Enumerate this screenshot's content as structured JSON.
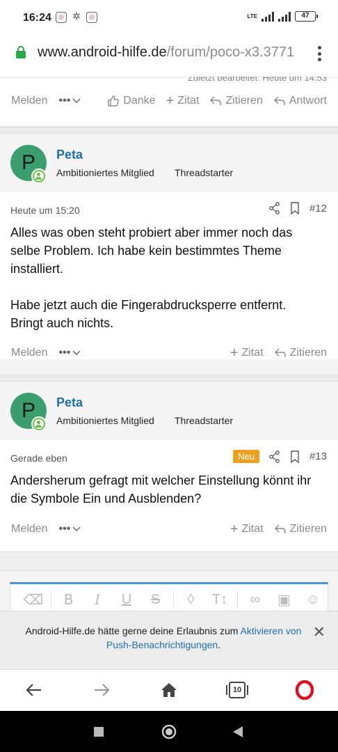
{
  "status_bar": {
    "time": "16:24",
    "battery": "47",
    "network": "LTE"
  },
  "browser": {
    "url_host": "www.android-hilfe.de",
    "url_path": "/forum/poco-x3.3771",
    "tabs_count": "10"
  },
  "top_partial": {
    "edited_text": "Zuletzt bearbeitet: Heute um 14:53"
  },
  "post_actions_first": {
    "report": "Melden",
    "thanks": "Danke",
    "quote_short": "Zitat",
    "quote": "Zitieren",
    "reply": "Antwort"
  },
  "posts": [
    {
      "author": "Peta",
      "avatar_letter": "P",
      "role": "Ambitioniertes Mitglied",
      "starter": "Threadstarter",
      "time": "Heute um 15:20",
      "number": "#12",
      "badge": "",
      "text": "Alles was oben steht probiert aber immer noch das selbe Problem. Ich habe kein bestimmtes Theme installiert.\n\nHabe jetzt auch die Fingerabdrucksperre entfernt. Bringt auch nichts.",
      "actions": {
        "report": "Melden",
        "quote_short": "Zitat",
        "quote": "Zitieren"
      }
    },
    {
      "author": "Peta",
      "avatar_letter": "P",
      "role": "Ambitioniertes Mitglied",
      "starter": "Threadstarter",
      "time": "Gerade eben",
      "number": "#13",
      "badge": "Neu",
      "text": "Andersherum gefragt mit welcher Einstellung könnt ihr die Symbole Ein und Ausblenden?",
      "actions": {
        "report": "Melden",
        "quote_short": "Zitat",
        "quote": "Zitieren"
      }
    }
  ],
  "notification": {
    "text_before": "Android-Hilfe.de hätte gerne deine Erlaubnis zum ",
    "link": "Aktivieren von Push-Benachrichtigungen",
    "text_after": "."
  },
  "icons": {
    "lock": "lock-icon",
    "menu": "kebab-menu-icon",
    "share": "share-icon",
    "bookmark": "bookmark-icon",
    "back": "back-arrow-icon",
    "forward": "forward-arrow-icon",
    "home": "home-icon",
    "tabs": "tabs-icon",
    "opera": "opera-icon"
  },
  "colors": {
    "accent": "#1f6fa8",
    "avatar": "#3a9e6e",
    "badge_new": "#f0a020",
    "lock": "#2aa84a"
  }
}
